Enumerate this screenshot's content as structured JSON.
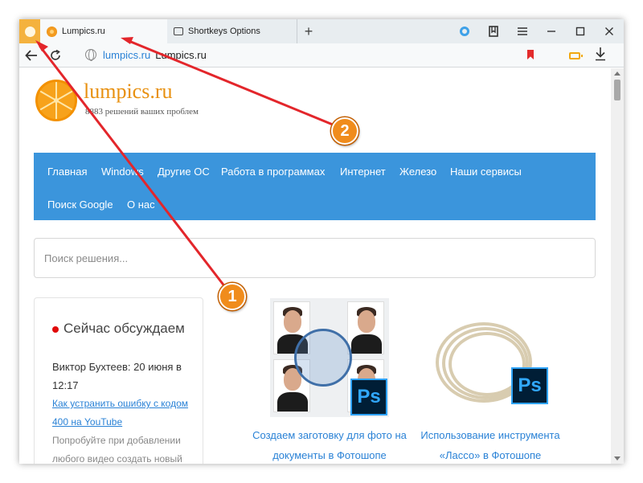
{
  "tabs": [
    {
      "label": "Lumpics.ru",
      "active": true
    },
    {
      "label": "Shortkeys Options",
      "active": false
    }
  ],
  "new_tab_label": "+",
  "address": {
    "host": "lumpics.ru",
    "title": "Lumpics.ru"
  },
  "site": {
    "title": "lumpics.ru",
    "subtitle": "8883 решений ваших проблем"
  },
  "menu": [
    "Главная",
    "Windows",
    "Другие ОС",
    "Работа в программах",
    "Интернет",
    "Железо",
    "Наши сервисы",
    "Поиск Google",
    "О нас"
  ],
  "search": {
    "placeholder": "Поиск решения..."
  },
  "sidebar": {
    "title": "Сейчас обсуждаем",
    "author": "Виктор Бухтеев: 20 июня в 12:17",
    "link": "Как устранить ошибку с кодом 400 на YouTube",
    "text": "Попробуйте при добавлении любого видео создать новый плейлист, нажав на"
  },
  "cards": [
    {
      "caption": "Создаем заготовку для фото на документы в Фотошопе",
      "badge": "Ps"
    },
    {
      "caption": "Использование инструмента «Лассо» в Фотошопе",
      "badge": "Ps"
    }
  ],
  "callouts": [
    {
      "number": "1"
    },
    {
      "number": "2"
    }
  ],
  "colors": {
    "accent": "#3b95dc",
    "brand": "#e8900f",
    "link": "#2a82d6",
    "callout": "#f08c1c",
    "arrow": "#e3262b"
  },
  "icons": [
    "yandex-button-icon",
    "back-arrow-icon",
    "reload-icon",
    "globe-icon",
    "bookmark-icon",
    "battery-icon",
    "download-icon",
    "alice-icon",
    "bookmarks-panel-icon",
    "menu-icon",
    "minimize-icon",
    "maximize-icon",
    "close-icon"
  ]
}
